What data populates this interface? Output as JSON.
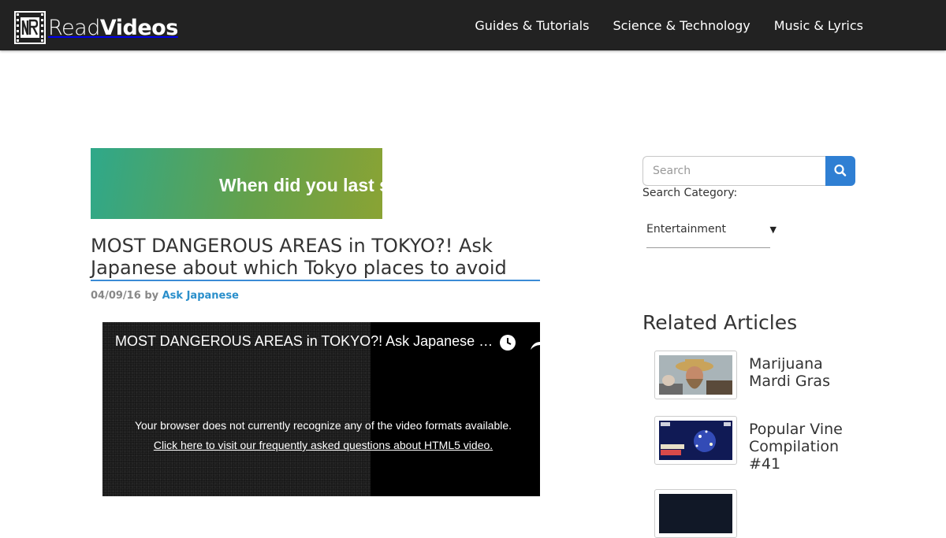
{
  "header": {
    "logo_text_light": "Read",
    "logo_text_bold": "Videos",
    "nav": [
      {
        "label": "Guides & Tutorials"
      },
      {
        "label": "Science & Technology"
      },
      {
        "label": "Music & Lyrics"
      }
    ]
  },
  "banner": {
    "text": "When did you last s"
  },
  "article": {
    "title": "MOST DANGEROUS AREAS in TOKYO?! Ask Japanese about which Tokyo places to avoid",
    "date": "04/09/16",
    "by": "by",
    "author": "Ask Japanese"
  },
  "video": {
    "title": "MOST DANGEROUS AREAS in TOKYO?! Ask Japanese about which Tokyo places to avoid",
    "message": "Your browser does not currently recognize any of the video formats available.",
    "link": "Click here to visit our frequently asked questions about HTML5 video."
  },
  "sidebar": {
    "search": {
      "placeholder": "Search",
      "value": ""
    },
    "category_label": "Search Category:",
    "category_selected": "Entertainment",
    "related_heading": "Related Articles",
    "related": [
      {
        "title": "Marijuana Mardi Gras"
      },
      {
        "title": "Popular Vine Compilation #41"
      }
    ]
  },
  "colors": {
    "header_bg": "#222222",
    "accent_blue": "#2f7fd3",
    "author_link": "#2a8fcb",
    "banner_gradient_start": "#2fa88a",
    "banner_gradient_end": "#8aa334"
  },
  "icons": [
    "logo-film-icon",
    "search-icon",
    "clock-icon",
    "share-icon",
    "chevron-down-icon"
  ]
}
